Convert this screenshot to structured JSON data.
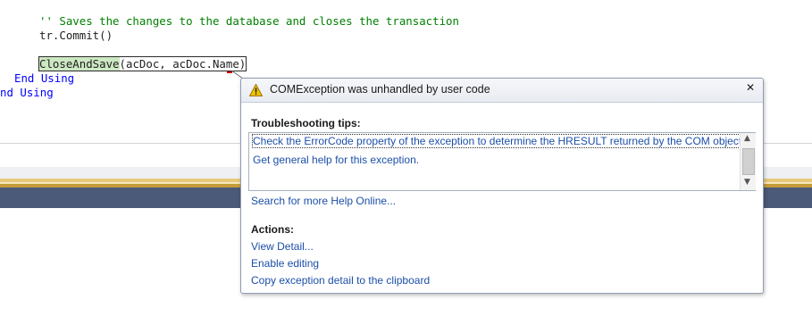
{
  "editor": {
    "comment_line": "'' Saves the changes to the database and closes the transaction",
    "commit_line": "tr.Commit()",
    "call_method": "CloseAndSave",
    "call_args": "(acDoc, acDoc.Name)",
    "end_using_1": "End Using",
    "end_using_2": "nd Using"
  },
  "popup": {
    "title": "COMException was unhandled by user code",
    "troubleshooting_label": "Troubleshooting tips:",
    "tips": [
      "Check the ErrorCode property of the exception to determine the HRESULT returned by the COM object.",
      "Get general help for this exception."
    ],
    "search_link": "Search for more Help Online...",
    "actions_label": "Actions:",
    "actions": [
      "View Detail...",
      "Enable editing",
      "Copy exception detail to the clipboard"
    ],
    "close_glyph": "✕"
  },
  "icons": {
    "warning": "warning-icon",
    "close": "close-icon",
    "scroll_up": "scroll-up-icon",
    "scroll_down": "scroll-down-icon"
  },
  "colors": {
    "comment": "#008000",
    "keyword": "#0000ff",
    "link": "#1c4fa8",
    "statement_highlight": "#cde8c2",
    "warning": "#f2c200"
  }
}
